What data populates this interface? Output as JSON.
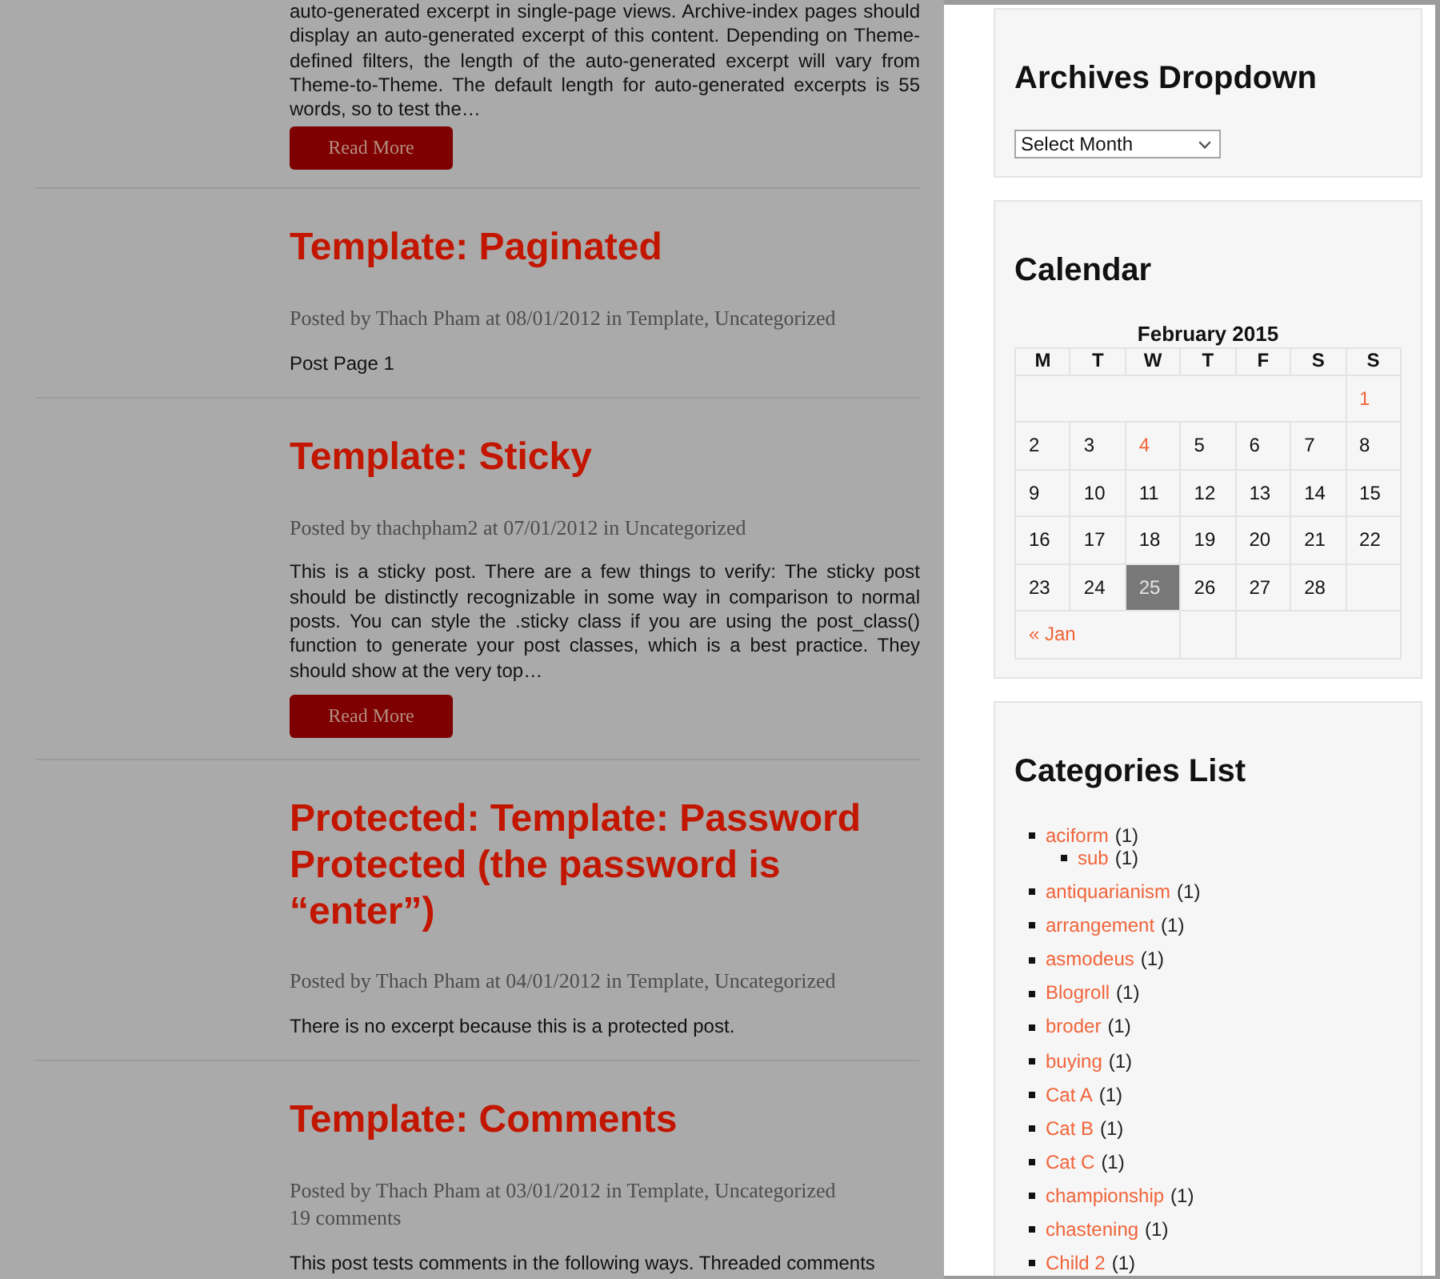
{
  "posts": [
    {
      "excerpt": "auto-generated excerpt in single-page views. Archive-index pages should display an auto-generated excerpt of this content. Depending on Theme-defined filters, the length of the auto-generated excerpt will vary from Theme-to-Theme. The default length for auto-generated excerpts is 55 words, so to test the…",
      "read_more": "Read More"
    },
    {
      "title": "Template: Paginated",
      "meta": "Posted by Thach Pham at 08/01/2012 in Template, Uncategorized",
      "excerpt": "Post Page 1"
    },
    {
      "title": "Template: Sticky",
      "meta": "Posted by thachpham2 at 07/01/2012 in Uncategorized",
      "excerpt": "This is a sticky post. There are a few things to verify: The sticky post should be distinctly recognizable in some way in comparison to normal posts. You can style the .sticky class if you are using the post_class() function to generate your post classes, which is a best practice. They should show at the very top…",
      "read_more": "Read More"
    },
    {
      "title": "Protected: Template: Password Protected (the password is “enter”)",
      "meta": "Posted by Thach Pham at 04/01/2012 in Template, Uncategorized",
      "excerpt": "There is no excerpt because this is a protected post."
    },
    {
      "title": "Template: Comments",
      "meta": "Posted by Thach Pham at 03/01/2012 in Template, Uncategorized",
      "comments": "19 comments",
      "excerpt": "This post tests comments in the following ways. Threaded comments"
    }
  ],
  "sidebar": {
    "widgets": [
      {
        "kind": "archives",
        "title": "Archives Dropdown",
        "select": {
          "value": "Select Month"
        }
      },
      {
        "kind": "calendar",
        "title": "Calendar",
        "caption": "February 2015",
        "weekdays": [
          "M",
          "T",
          "W",
          "T",
          "F",
          "S",
          "S"
        ],
        "weeks": [
          [
            {
              "day": "1",
              "linked": true,
              "today": false
            }
          ],
          [
            {
              "day": "2",
              "linked": false,
              "today": false
            },
            {
              "day": "3",
              "linked": false,
              "today": false
            },
            {
              "day": "4",
              "linked": true,
              "today": false
            },
            {
              "day": "5",
              "linked": false,
              "today": false
            },
            {
              "day": "6",
              "linked": false,
              "today": false
            },
            {
              "day": "7",
              "linked": false,
              "today": false
            },
            {
              "day": "8",
              "linked": false,
              "today": false
            }
          ],
          [
            {
              "day": "9",
              "linked": false,
              "today": false
            },
            {
              "day": "10",
              "linked": false,
              "today": false
            },
            {
              "day": "11",
              "linked": false,
              "today": false
            },
            {
              "day": "12",
              "linked": false,
              "today": false
            },
            {
              "day": "13",
              "linked": false,
              "today": false
            },
            {
              "day": "14",
              "linked": false,
              "today": false
            },
            {
              "day": "15",
              "linked": false,
              "today": false
            }
          ],
          [
            {
              "day": "16",
              "linked": false,
              "today": false
            },
            {
              "day": "17",
              "linked": false,
              "today": false
            },
            {
              "day": "18",
              "linked": false,
              "today": false
            },
            {
              "day": "19",
              "linked": false,
              "today": false
            },
            {
              "day": "20",
              "linked": false,
              "today": false
            },
            {
              "day": "21",
              "linked": false,
              "today": false
            },
            {
              "day": "22",
              "linked": false,
              "today": false
            }
          ],
          [
            {
              "day": "23",
              "linked": false,
              "today": false
            },
            {
              "day": "24",
              "linked": false,
              "today": false
            },
            {
              "day": "25",
              "linked": false,
              "today": true
            },
            {
              "day": "26",
              "linked": false,
              "today": false
            },
            {
              "day": "27",
              "linked": false,
              "today": false
            },
            {
              "day": "28",
              "linked": false,
              "today": false
            }
          ]
        ],
        "prev": "« Jan"
      },
      {
        "kind": "categories",
        "title": "Categories List",
        "items": [
          {
            "name": "aciform",
            "count": "(1)",
            "children": [
              {
                "name": "sub",
                "count": "(1)"
              }
            ]
          },
          {
            "name": "antiquarianism",
            "count": "(1)"
          },
          {
            "name": "arrangement",
            "count": "(1)"
          },
          {
            "name": "asmodeus",
            "count": "(1)"
          },
          {
            "name": "Blogroll",
            "count": "(1)"
          },
          {
            "name": "broder",
            "count": "(1)"
          },
          {
            "name": "buying",
            "count": "(1)"
          },
          {
            "name": "Cat A",
            "count": "(1)"
          },
          {
            "name": "Cat B",
            "count": "(1)"
          },
          {
            "name": "Cat C",
            "count": "(1)"
          },
          {
            "name": "championship",
            "count": "(1)"
          },
          {
            "name": "chastening",
            "count": "(1)"
          },
          {
            "name": "Child 2",
            "count": "(1)"
          }
        ]
      }
    ]
  }
}
